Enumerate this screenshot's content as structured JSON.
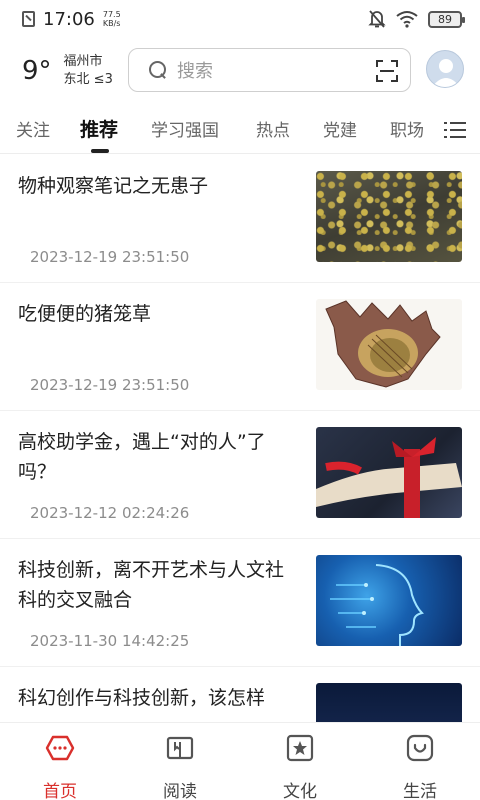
{
  "status_bar": {
    "time": "17:06",
    "net_speed_value": "77.5",
    "net_speed_unit": "KB/s",
    "battery": "89"
  },
  "header": {
    "weather": {
      "temp": "9°",
      "city": "福州市",
      "wind": "东北 ≤3"
    },
    "search": {
      "placeholder": "搜索"
    }
  },
  "tabs": [
    {
      "label": "关注"
    },
    {
      "label": "推荐",
      "active": true
    },
    {
      "label": "学习强国"
    },
    {
      "label": "热点"
    },
    {
      "label": "党建"
    },
    {
      "label": "职场"
    }
  ],
  "articles": [
    {
      "title": "物种观察笔记之无患子",
      "time": "2023-12-19 23:51:50"
    },
    {
      "title": "吃便便的猪笼草",
      "time": "2023-12-19 23:51:50"
    },
    {
      "title": "高校助学金，遇上“对的人”了吗？",
      "time": "2023-12-12 02:24:26"
    },
    {
      "title": "科技创新，离不开艺术与人文社科的交叉融合",
      "time": "2023-11-30 14:42:25"
    },
    {
      "title": "科幻创作与科技创新，该怎样",
      "time": ""
    }
  ],
  "bottom_nav": [
    {
      "label": "首页",
      "icon": "home-icon",
      "active": true
    },
    {
      "label": "阅读",
      "icon": "book-icon"
    },
    {
      "label": "文化",
      "icon": "culture-star-icon"
    },
    {
      "label": "生活",
      "icon": "life-smile-icon"
    }
  ],
  "colors": {
    "accent": "#d9302c",
    "text": "#222222",
    "muted": "#8c8c8c"
  }
}
